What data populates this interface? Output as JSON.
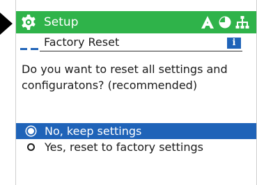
{
  "header": {
    "title": "Setup",
    "icons": [
      "gear-icon",
      "warning-a-icon",
      "status-circle-icon",
      "network-icon"
    ]
  },
  "subheader": {
    "title": "Factory Reset",
    "info_icon": "info-icon",
    "info_glyph": "i"
  },
  "question": {
    "text": "Do you want to reset all settings and configuratons? (recommended)"
  },
  "options": [
    {
      "label": "No, keep settings",
      "selected": true
    },
    {
      "label": "Yes, reset to factory settings",
      "selected": false
    }
  ],
  "colors": {
    "header_bg": "#2fb34a",
    "accent": "#1f63b8",
    "text": "#1a1a1a"
  }
}
